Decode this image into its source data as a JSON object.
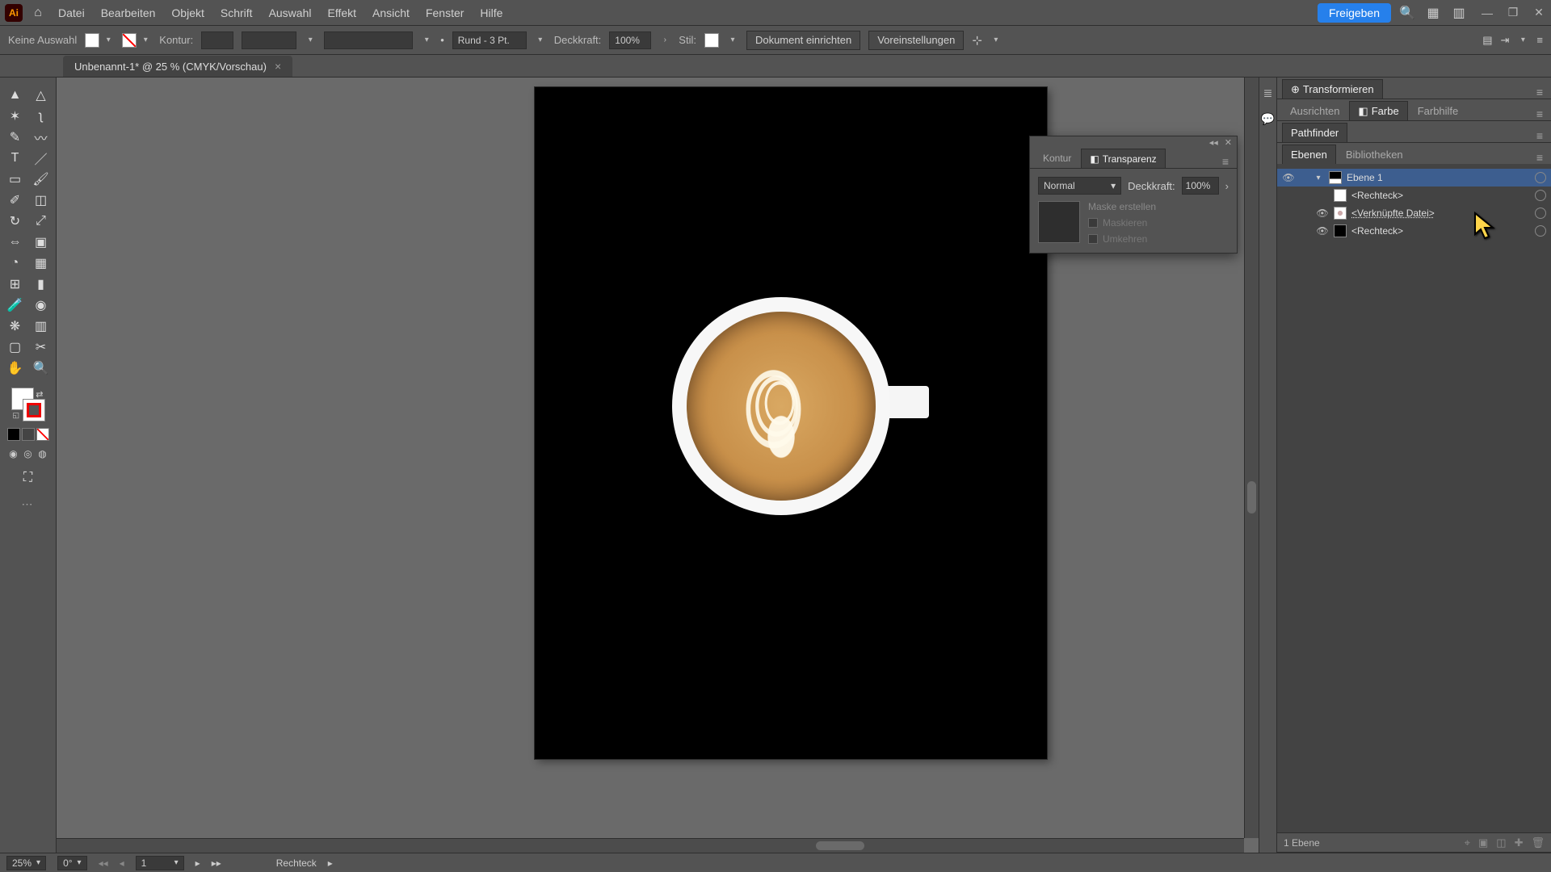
{
  "app": {
    "badge": "Ai"
  },
  "menu": {
    "items": [
      "Datei",
      "Bearbeiten",
      "Objekt",
      "Schrift",
      "Auswahl",
      "Effekt",
      "Ansicht",
      "Fenster",
      "Hilfe"
    ],
    "share": "Freigeben"
  },
  "control": {
    "selectionLabel": "Keine Auswahl",
    "strokeLabel": "Kontur:",
    "strokeWeight": "",
    "capProfile": "Rund - 3 Pt.",
    "opacityLabel": "Deckkraft:",
    "opacityValue": "100%",
    "styleLabel": "Stil:",
    "docSetup": "Dokument einrichten",
    "preferences": "Voreinstellungen"
  },
  "tab": {
    "title": "Unbenannt-1* @ 25 % (CMYK/Vorschau)"
  },
  "transparency": {
    "tabs": {
      "stroke": "Kontur",
      "transparency": "Transparenz"
    },
    "blendMode": "Normal",
    "opacityLabel": "Deckkraft:",
    "opacityValue": "100%",
    "makeMask": "Maske erstellen",
    "clip": "Maskieren",
    "invert": "Umkehren"
  },
  "rightPanels": {
    "transform": "Transformieren",
    "align": "Ausrichten",
    "color": "Farbe",
    "colorGuide": "Farbhilfe",
    "pathfinder": "Pathfinder",
    "layers": "Ebenen",
    "libraries": "Bibliotheken"
  },
  "layers": {
    "root": "Ebene 1",
    "items": [
      {
        "name": "<Rechteck>"
      },
      {
        "name": "<Verknüpfte Datei>"
      },
      {
        "name": "<Rechteck>"
      }
    ]
  },
  "panelStatus": {
    "count": "1 Ebene"
  },
  "status": {
    "zoom": "25%",
    "rotate": "0°",
    "artboard": "1",
    "tool": "Rechteck"
  }
}
